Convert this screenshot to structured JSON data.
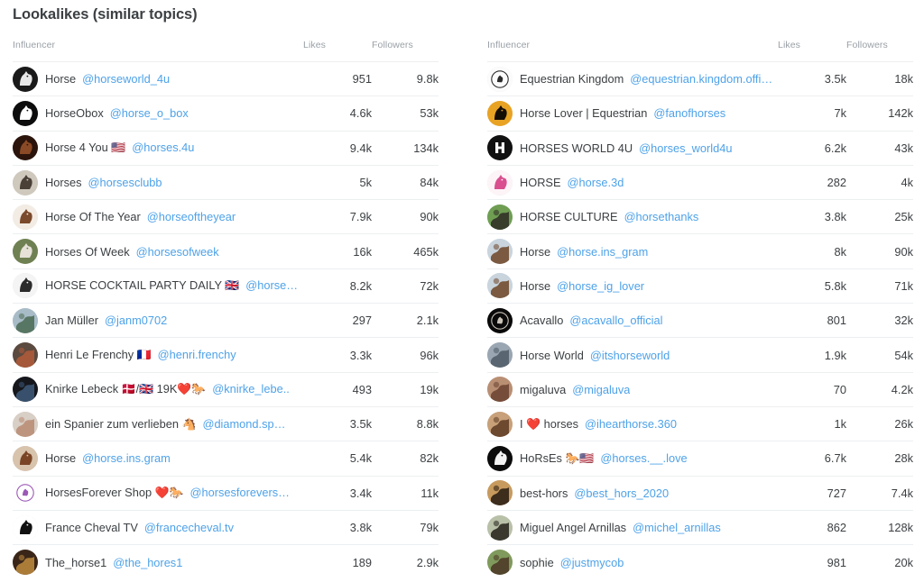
{
  "header": {
    "title": "Lookalikes (similar topics)"
  },
  "colors": {
    "link": "#4ea2e8",
    "text": "#3c4043",
    "muted": "#9aa0a6",
    "divider": "#eceff1",
    "background": "#ffffff"
  },
  "columns": {
    "influencer": "Influencer",
    "likes": "Likes",
    "followers": "Followers"
  },
  "left_table": {
    "rows": [
      {
        "avatar": "horse-dark-logo",
        "name": "Horse",
        "handle": "@horseworld_4u",
        "likes": "951",
        "followers": "9.8k"
      },
      {
        "avatar": "horse-white-on-black",
        "name": "HorseObox",
        "handle": "@horse_o_box",
        "likes": "4.6k",
        "followers": "53k"
      },
      {
        "avatar": "brown-horse-head",
        "name": "Horse 4 You 🇺🇸",
        "handle": "@horses.4u",
        "likes": "9.4k",
        "followers": "134k"
      },
      {
        "avatar": "grey-horse-head",
        "name": "Horses",
        "handle": "@horsesclubb",
        "likes": "5k",
        "followers": "84k"
      },
      {
        "avatar": "pinto-horse",
        "name": "Horse Of The Year",
        "handle": "@horseoftheyear",
        "likes": "7.9k",
        "followers": "90k"
      },
      {
        "avatar": "white-horse-green",
        "name": "Horses Of Week",
        "handle": "@horsesofweek",
        "likes": "16k",
        "followers": "465k"
      },
      {
        "avatar": "cocktail-logo",
        "name": "HORSE COCKTAIL PARTY DAILY 🇬🇧",
        "handle": "@horse…",
        "likes": "8.2k",
        "followers": "72k"
      },
      {
        "avatar": "photo-person",
        "name": "Jan Müller",
        "handle": "@janm0702",
        "likes": "297",
        "followers": "2.1k"
      },
      {
        "avatar": "photo-rider",
        "name": "Henri Le Frenchy 🇫🇷",
        "handle": "@henri.frenchy",
        "likes": "3.3k",
        "followers": "96k"
      },
      {
        "avatar": "dark-photo",
        "name": "Knirke Lebeck 🇩🇰/🇬🇧 19K❤️🐎",
        "handle": "@knirke_lebe..",
        "likes": "493",
        "followers": "19k"
      },
      {
        "avatar": "light-photo",
        "name": "ein Spanier zum verlieben 🐴",
        "handle": "@diamond.sp…",
        "likes": "3.5k",
        "followers": "8.8k"
      },
      {
        "avatar": "brown-horse-portrait",
        "name": "Horse",
        "handle": "@horse.ins.gram",
        "likes": "5.4k",
        "followers": "82k"
      },
      {
        "avatar": "shop-logo-purple",
        "name": "HorsesForever Shop ❤️🐎",
        "handle": "@horsesforevers…",
        "likes": "3.4k",
        "followers": "11k"
      },
      {
        "avatar": "black-horse-silhouette",
        "name": "France Cheval TV",
        "handle": "@francecheval.tv",
        "likes": "3.8k",
        "followers": "79k"
      },
      {
        "avatar": "golden-horse",
        "name": "The_horse1",
        "handle": "@the_hores1",
        "likes": "189",
        "followers": "2.9k"
      }
    ]
  },
  "right_table": {
    "rows": [
      {
        "avatar": "equestrian-kingdom-logo",
        "name": "Equestrian Kingdom",
        "handle": "@equestrian.kingdom.offic…",
        "likes": "3.5k",
        "followers": "18k"
      },
      {
        "avatar": "sunset-horse",
        "name": "Horse Lover | Equestrian",
        "handle": "@fanofhorses",
        "likes": "7k",
        "followers": "142k"
      },
      {
        "avatar": "h-monogram",
        "name": "HORSES WORLD 4U",
        "handle": "@horses_world4u",
        "likes": "6.2k",
        "followers": "43k"
      },
      {
        "avatar": "pink-horse-logo",
        "name": "HORSE",
        "handle": "@horse.3d",
        "likes": "282",
        "followers": "4k"
      },
      {
        "avatar": "horse-field",
        "name": "HORSE CULTURE",
        "handle": "@horsethanks",
        "likes": "3.8k",
        "followers": "25k"
      },
      {
        "avatar": "two-horses",
        "name": "Horse",
        "handle": "@horse.ins_gram",
        "likes": "8k",
        "followers": "90k"
      },
      {
        "avatar": "two-horses",
        "name": "Horse",
        "handle": "@horse_ig_lover",
        "likes": "5.8k",
        "followers": "71k"
      },
      {
        "avatar": "acavallo-logo",
        "name": "Acavallo",
        "handle": "@acavallo_official",
        "likes": "801",
        "followers": "32k"
      },
      {
        "avatar": "crowd-photo",
        "name": "Horse World",
        "handle": "@itshorseworld",
        "likes": "1.9k",
        "followers": "54k"
      },
      {
        "avatar": "rider-photo",
        "name": "migaluva",
        "handle": "@migaluva",
        "likes": "70",
        "followers": "4.2k"
      },
      {
        "avatar": "horse-closeup",
        "name": "I ❤️ horses",
        "handle": "@ihearthorse.360",
        "likes": "1k",
        "followers": "26k"
      },
      {
        "avatar": "black-circle-horse",
        "name": "HoRsEs 🐎🇺🇸",
        "handle": "@horses.__.love",
        "likes": "6.7k",
        "followers": "28k"
      },
      {
        "avatar": "horse-sunset-beach",
        "name": "best-hors",
        "handle": "@best_hors_2020",
        "likes": "727",
        "followers": "7.4k"
      },
      {
        "avatar": "horse-rider-field",
        "name": "Miguel Angel Arnillas",
        "handle": "@michel_arnillas",
        "likes": "862",
        "followers": "128k"
      },
      {
        "avatar": "pony-green",
        "name": "sophie",
        "handle": "@justmycob",
        "likes": "981",
        "followers": "20k"
      }
    ]
  }
}
